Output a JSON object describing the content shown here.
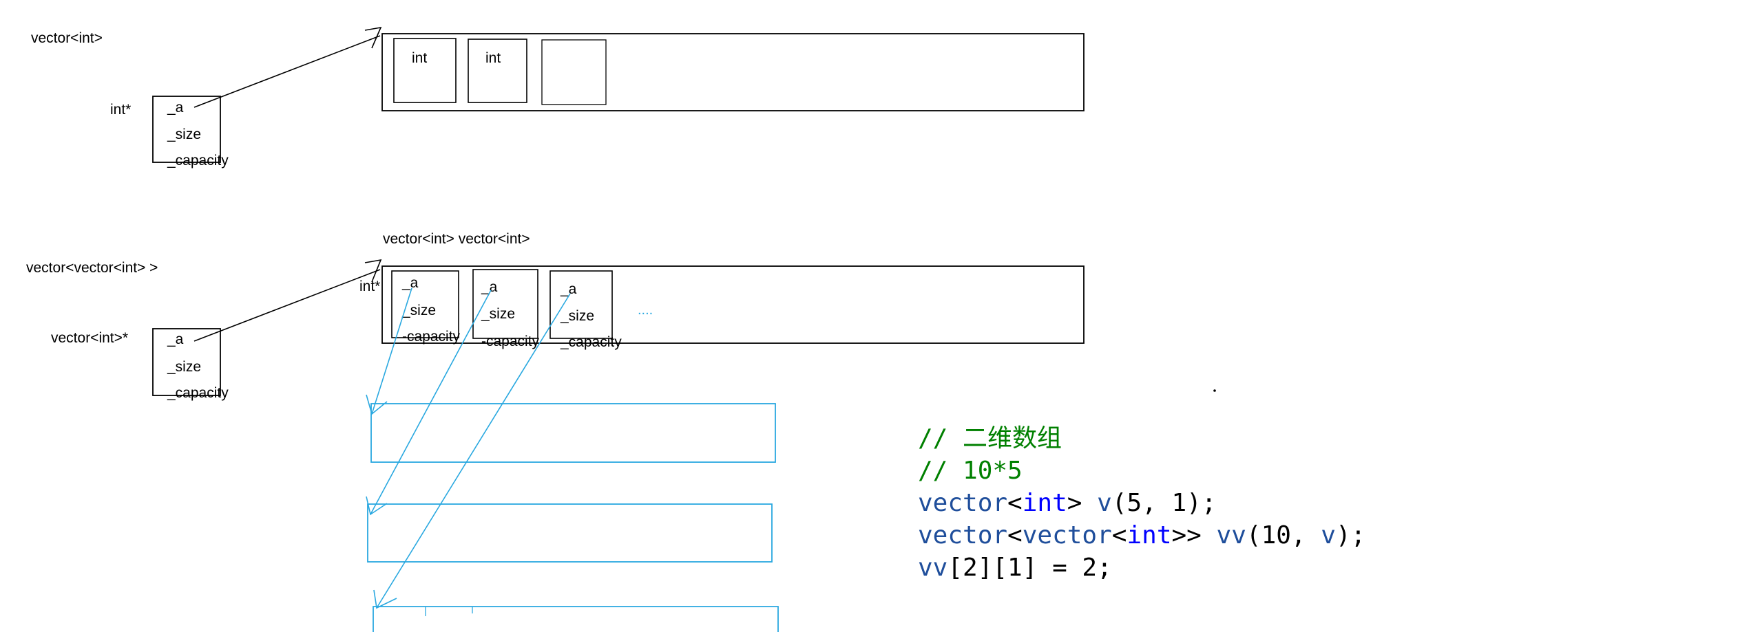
{
  "colors": {
    "ink": "#000000",
    "blue_ink": "#29a8e0",
    "code_comment": "#008000",
    "code_type": "#1f4e9b",
    "code_keyword": "#0000ff",
    "code_plain": "#000000"
  },
  "section1": {
    "title": "vector<int>",
    "ptr_type": "int*",
    "fields": [
      "_a",
      "_size",
      "_capacity"
    ],
    "cells": [
      "int",
      "int",
      ""
    ]
  },
  "section2": {
    "title": "vector<vector<int> >",
    "ptr_type": "vector<int>*",
    "fields": [
      "_a",
      "_size",
      "_capacity"
    ],
    "array_caption": "vector<int> vector<int>",
    "inner_ptr_type": "int*",
    "inner_blocks": [
      {
        "a": "_a",
        "size": "_size",
        "capacity": "-capacity"
      },
      {
        "a": "_a",
        "size": "_size",
        "capacity": "-capacity"
      },
      {
        "a": "_a",
        "size": "_size",
        "capacity": "_capacity"
      }
    ],
    "ellipsis": "...."
  },
  "code": {
    "comment_line1": "// 二维数组",
    "comment_line2": "// 10*5",
    "line3": {
      "t1": "vector",
      "p1": "<",
      "k1": "int",
      "p2": "> ",
      "t2": "v",
      "p3": "(5, 1);"
    },
    "line4": {
      "t1": "vector",
      "p1": "<",
      "t2": "vector",
      "p2": "<",
      "k1": "int",
      "p3": ">> ",
      "t3": "vv",
      "p4": "(10, ",
      "t4": "v",
      "p5": ");"
    },
    "line5": {
      "t1": "vv",
      "p1": "[2][1] = 2;"
    }
  }
}
